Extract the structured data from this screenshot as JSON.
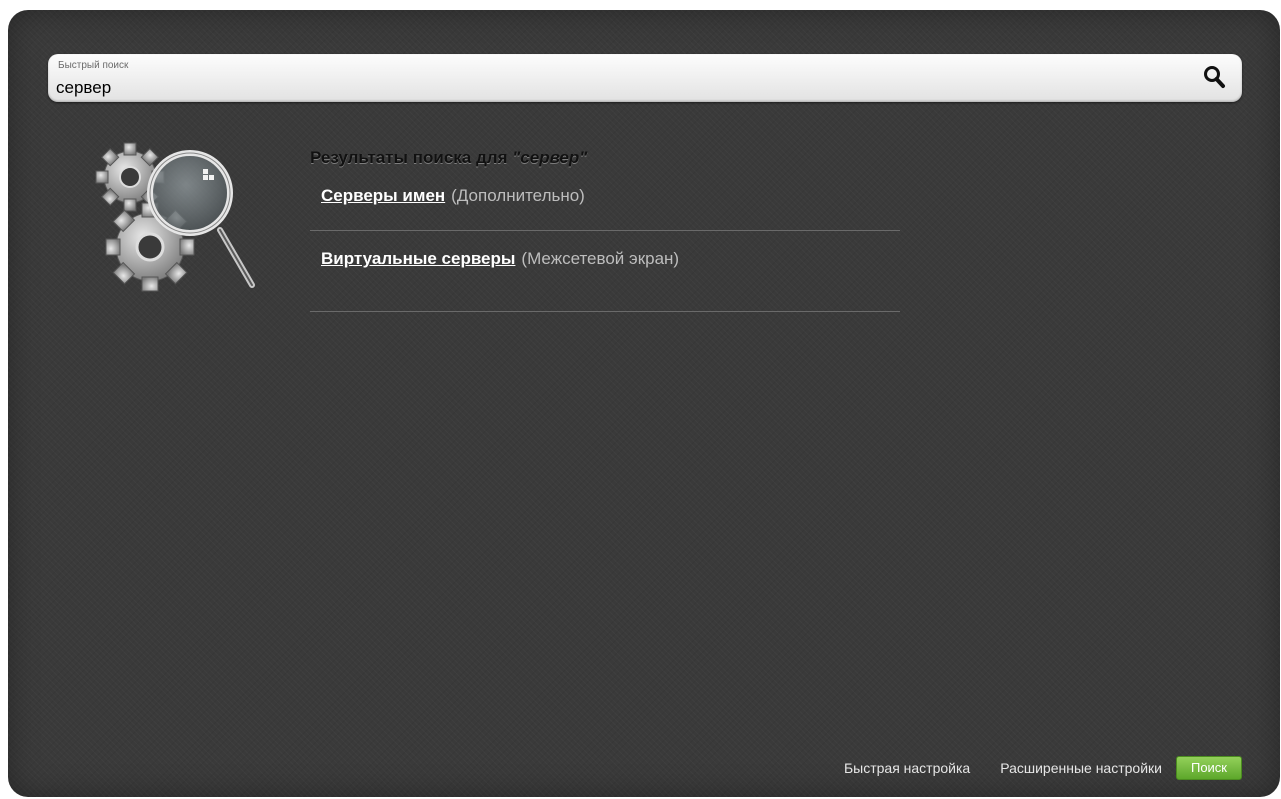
{
  "search": {
    "label": "Быстрый поиск",
    "value": "сервер"
  },
  "results": {
    "title_prefix": "Результаты поиска для",
    "query_display": "\"сервер\"",
    "items": [
      {
        "label": "Серверы имен",
        "section": "(Дополнительно)"
      },
      {
        "label": "Виртуальные серверы",
        "section": "(Межсетевой экран)"
      }
    ]
  },
  "footer": {
    "quick_setup": "Быстрая настройка",
    "advanced_settings": "Расширенные настройки",
    "search_button": "Поиск"
  },
  "icons": {
    "search": "magnifier-icon",
    "illustration": "gears-magnifier-icon"
  },
  "colors": {
    "panel_bg": "#3a3a3a",
    "accent_green": "#7cc043"
  }
}
